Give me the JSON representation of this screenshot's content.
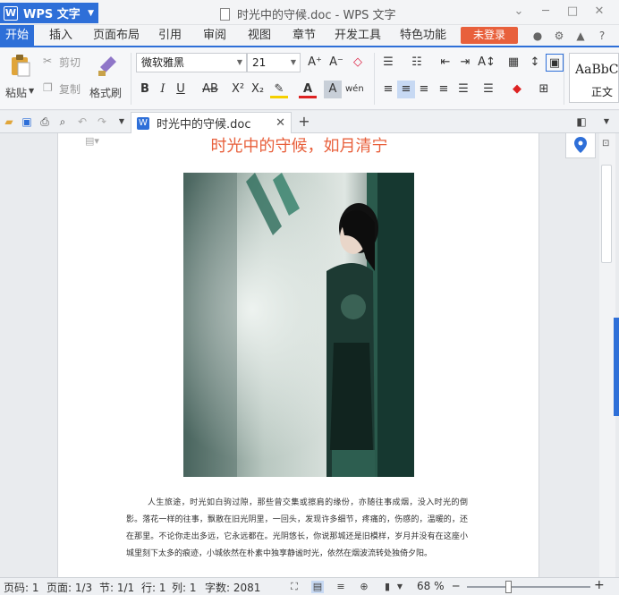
{
  "titlebar": {
    "app_name": "WPS 文字",
    "window_title": "时光中的守候.doc - WPS 文字",
    "minimize": "─",
    "maximize": "□",
    "close": "✕",
    "restore": "⌄"
  },
  "menu": {
    "items": [
      "开始",
      "插入",
      "页面布局",
      "引用",
      "审阅",
      "视图",
      "章节",
      "开发工具",
      "特色功能"
    ],
    "active": "开始",
    "login": "未登录"
  },
  "ribbon": {
    "paste": "粘贴",
    "cut": "剪切",
    "copy": "复制",
    "format_painter": "格式刷",
    "font_name": "微软雅黑",
    "font_size": "21",
    "style_preview": "AaBbC",
    "style_label": "正文"
  },
  "tabbar": {
    "doc_tab": "时光中的守候.doc",
    "close": "✕",
    "new_tab": "+"
  },
  "document": {
    "heading": "时光中的守候，如月清宁",
    "body_lines": [
      "人生旅途，时光如白驹过隙，那些曾交集或擦肩的缘份，亦随往事成烟，没入时光的",
      "倒影。落花一样的往事，飘散在旧光阴里，一回头，发现许多细节，疼痛的，伤感的，温",
      "暖的，还在那里。不论你走出多远，它永远都在。光阴悠长，你说那城还是旧模样，岁月",
      "并没有在这座小城里刻下太多的痕迹，小城依然在朴素中独享静谧时光，依然在烟波流转",
      "处独倚夕阳。"
    ]
  },
  "status": {
    "page_code": "页码: 1",
    "page": "页面: 1/3",
    "section": "节: 1/1",
    "row": "行: 1",
    "col": "列: 1",
    "word_count": "字数: 2081",
    "zoom": "68 %",
    "zoom_minus": "─",
    "zoom_plus": "+"
  },
  "colors": {
    "accent": "#2e6fd8",
    "login": "#e8603c",
    "heading": "#e8603c"
  }
}
